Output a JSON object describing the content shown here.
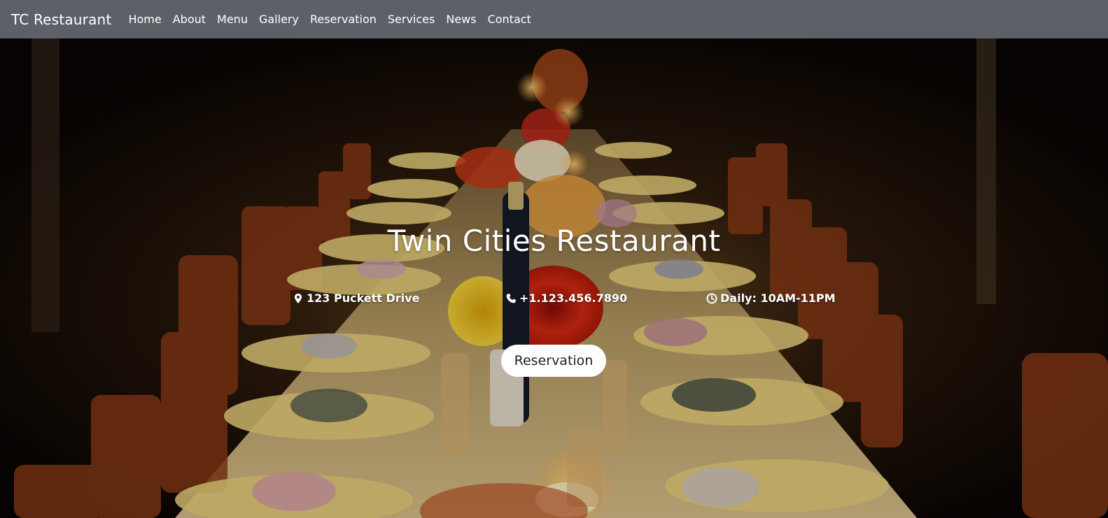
{
  "nav": {
    "brand": "TC Restaurant",
    "links": [
      "Home",
      "About",
      "Menu",
      "Gallery",
      "Reservation",
      "Services",
      "News",
      "Contact"
    ]
  },
  "hero": {
    "title": "Twin Cities Restaurant",
    "address": "123 Puckett Drive",
    "phone": "+1.123.456.7890",
    "hours": "Daily: 10AM-11PM",
    "button_label": "Reservation",
    "icons": {
      "address": "map-marker-icon",
      "phone": "phone-icon",
      "hours": "clock-icon"
    }
  },
  "colors": {
    "navbar": "#5d6167",
    "text": "#ffffff",
    "button_bg": "#ffffff",
    "button_text": "#222222"
  }
}
